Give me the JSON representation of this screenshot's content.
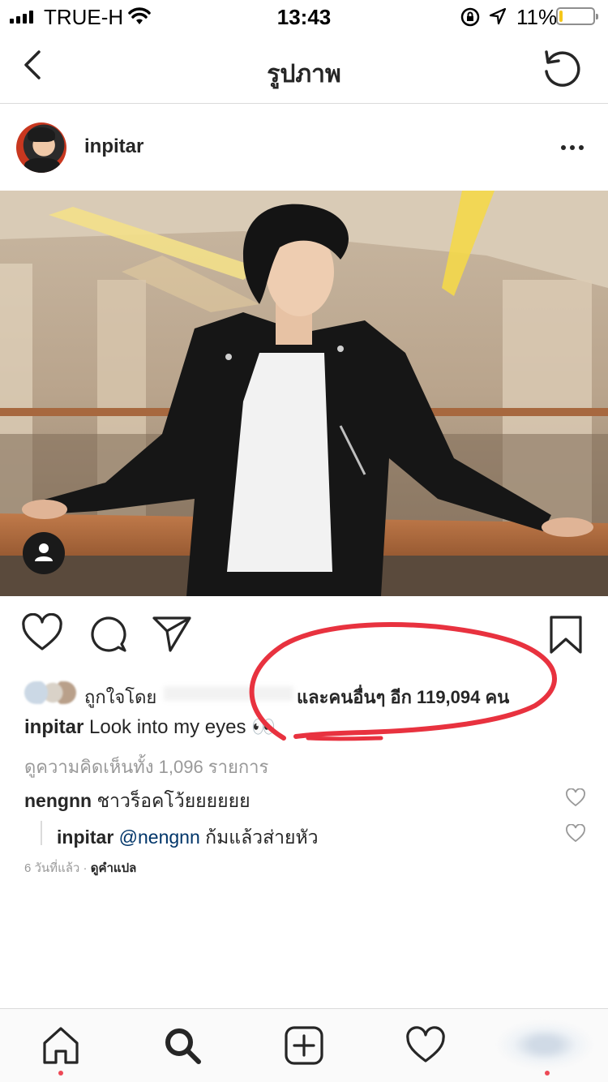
{
  "status_bar": {
    "carrier": "TRUE-H",
    "time": "13:43",
    "battery": "11%",
    "battery_level": 0.11,
    "battery_color": "#f5c71a"
  },
  "nav": {
    "title": "รูปภาพ",
    "back_icon": "chevron-left-icon",
    "refresh_icon": "refresh-icon"
  },
  "post": {
    "username": "inpitar",
    "more_icon": "ellipsis-icon",
    "photo_description_icon": "tag-people-icon"
  },
  "actions": {
    "like_icon": "heart-outline-icon",
    "comment_icon": "comment-bubble-icon",
    "share_icon": "paper-plane-icon",
    "save_icon": "bookmark-icon"
  },
  "likes": {
    "liked_by_label": "ถูกใจโดย",
    "others_text": "และคนอื่นๆ อีก 119,094 คน"
  },
  "caption": {
    "username": "inpitar",
    "text": "Look into my eyes 👀"
  },
  "view_comments": "ดูความคิดเห็นทั้ง 1,096 รายการ",
  "comments": [
    {
      "username": "nengnn",
      "text": "ชาวร็อคโว้ยยยยยย"
    }
  ],
  "reply": {
    "username": "inpitar",
    "mention": "@nengnn",
    "text": "ก้มแล้วส่ายหัว"
  },
  "meta": {
    "time_ago": "6 วันที่แล้ว",
    "separator": "·",
    "translate": "ดูคำแปล"
  },
  "tabbar": {
    "home_icon": "home-icon",
    "search_icon": "search-icon",
    "add_icon": "plus-square-icon",
    "activity_icon": "heart-icon",
    "profile_icon": "profile-avatar-icon",
    "notification_dot_color": "#ed4956"
  },
  "colors": {
    "text": "#262626",
    "secondary_text": "#999999",
    "link": "#003569",
    "annotation": "#e8323f",
    "divider": "#dbdbdb"
  }
}
